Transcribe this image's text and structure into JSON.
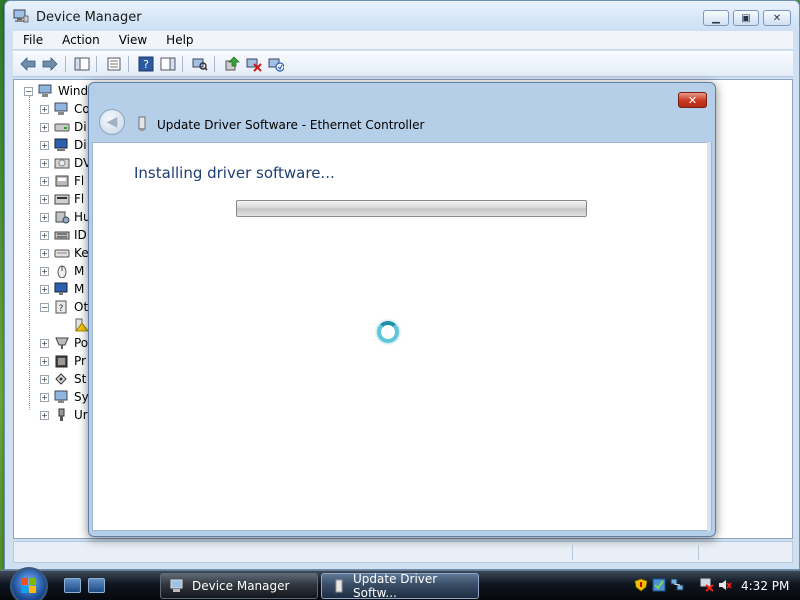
{
  "window": {
    "title": "Device Manager",
    "min_icon": "minimize-icon",
    "max_icon": "maximize-icon",
    "close_icon": "close-icon"
  },
  "menu": {
    "items": [
      "File",
      "Action",
      "View",
      "Help"
    ]
  },
  "toolbar": {
    "icons": [
      "back-arrow-icon",
      "forward-arrow-icon",
      "show-hide-console-tree-icon",
      "properties-icon",
      "help-icon",
      "show-hide-action-pane-icon",
      "scan-hardware-icon",
      "update-driver-icon",
      "disable-device-icon",
      "uninstall-device-icon"
    ]
  },
  "tree": {
    "root_label": "Windo",
    "items": [
      {
        "label": "Co",
        "icon": "computer-icon",
        "expander": "+"
      },
      {
        "label": "Di",
        "icon": "disk-drive-icon",
        "expander": "+"
      },
      {
        "label": "Di",
        "icon": "display-adapter-icon",
        "expander": "+"
      },
      {
        "label": "DV",
        "icon": "dvd-drive-icon",
        "expander": "+"
      },
      {
        "label": "Fl",
        "icon": "floppy-controller-icon",
        "expander": "+"
      },
      {
        "label": "Fl",
        "icon": "floppy-drive-icon",
        "expander": "+"
      },
      {
        "label": "Hu",
        "icon": "hid-device-icon",
        "expander": "+"
      },
      {
        "label": "ID",
        "icon": "ide-controller-icon",
        "expander": "+"
      },
      {
        "label": "Ke",
        "icon": "keyboard-icon",
        "expander": "+"
      },
      {
        "label": "M",
        "icon": "mouse-icon",
        "expander": "+"
      },
      {
        "label": "M",
        "icon": "monitor-icon",
        "expander": "+"
      },
      {
        "label": "Ot",
        "icon": "other-devices-icon",
        "expander": "−"
      },
      {
        "label": "",
        "icon": "warning-device-icon",
        "expander": ""
      },
      {
        "label": "Po",
        "icon": "ports-icon",
        "expander": "+"
      },
      {
        "label": "Pr",
        "icon": "processor-icon",
        "expander": "+"
      },
      {
        "label": "St",
        "icon": "storage-controller-icon",
        "expander": "+"
      },
      {
        "label": "Sy",
        "icon": "system-devices-icon",
        "expander": "+"
      },
      {
        "label": "Ur",
        "icon": "usb-controller-icon",
        "expander": "+"
      }
    ]
  },
  "dialog": {
    "title": "Update Driver Software - Ethernet Controller",
    "heading": "Installing driver software...",
    "progress": 0,
    "close_label": "✕",
    "back_icon": "back-arrow-icon",
    "busy_icon": "busy-spinner-icon"
  },
  "taskbar": {
    "tasks": [
      {
        "label": "Device Manager",
        "icon": "device-manager-icon"
      },
      {
        "label": "Update Driver Softw...",
        "icon": "update-driver-icon"
      }
    ],
    "tray_icons": [
      "security-shield-icon",
      "windows-update-icon",
      "network-icon",
      "network-error-icon",
      "volume-muted-icon"
    ],
    "clock": "4:32 PM"
  },
  "colors": {
    "dialog_heading": "#1e3e74",
    "title_bar": "#d6e6f7",
    "close_button": "#c9371f",
    "spinner": "#5cc7d8"
  }
}
